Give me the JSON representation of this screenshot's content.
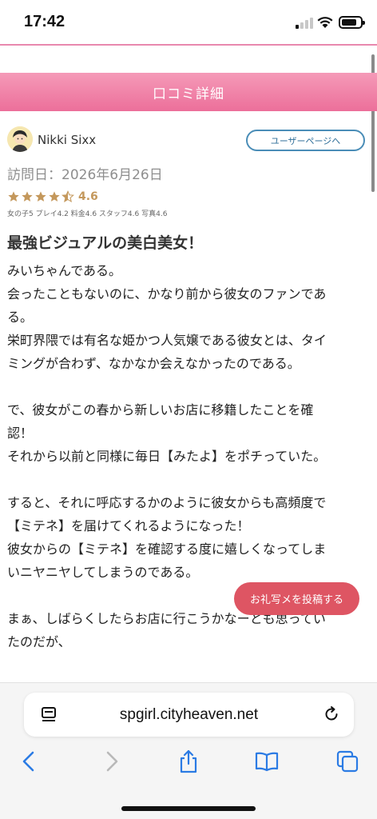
{
  "status": {
    "time": "17:42"
  },
  "header": {
    "title": "口コミ詳細"
  },
  "reviewer": {
    "name": "Nikki Sixx",
    "user_page_button": "ユーザーページへ"
  },
  "visit_date": "訪問日：2026年6月26日",
  "rating": {
    "stars": 4.6,
    "value": "4.6",
    "sub_scores": "女の子5 プレイ4.2 料金4.6 スタッフ4.6 写真4.6"
  },
  "review": {
    "title": "最強ビジュアルの美白美女！",
    "lines": [
      "みいちゃんである。",
      "会ったこともないのに、かなり前から彼女のファンであ",
      "る。",
      "栄町界隈では有名な姫かつ人気嬢である彼女とは、タイ",
      "ミングが合わず、なかなか会えなかったのである。",
      "",
      "で、彼女がこの春から新しいお店に移籍したことを確",
      "認！",
      "それから以前と同様に毎日【みたよ】をポチっていた。",
      "",
      "すると、それに呼応するかのように彼女からも高頻度で",
      "【ミテネ】を届けてくれるようになった！",
      "彼女からの【ミテネ】を確認する度に嬉しくなってしま",
      "いニヤニヤしてしまうのである。",
      "",
      "まぁ、しばらくしたらお店に行こうかなーとも思ってい",
      "たのだが、"
    ]
  },
  "floating_button": "お礼写メを投稿する",
  "browser": {
    "url": "spgirl.cityheaven.net"
  },
  "colors": {
    "accent_pink": "#ec6f9a",
    "star_gold": "#c4985c",
    "button_red": "#de5563",
    "link_blue": "#4a8db7"
  }
}
